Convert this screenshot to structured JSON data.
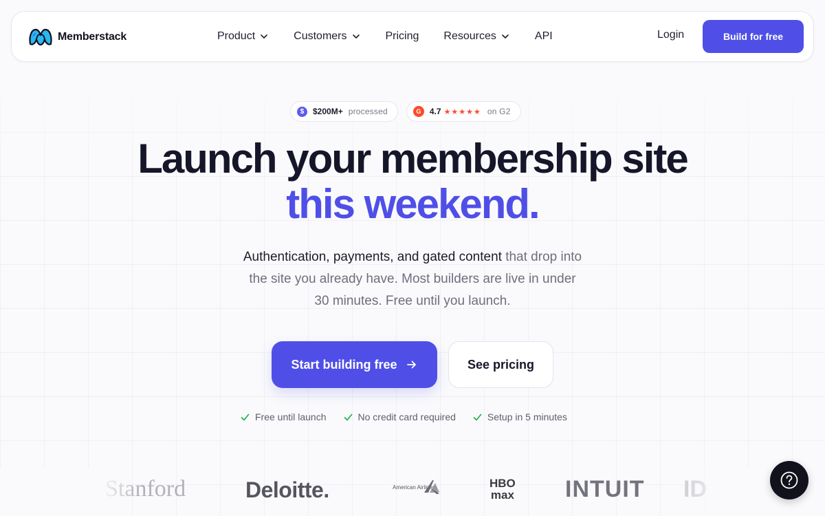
{
  "brand": {
    "name": "Memberstack",
    "accent": "#4f4fe8"
  },
  "nav": {
    "items": [
      {
        "label": "Product",
        "has_dropdown": true
      },
      {
        "label": "Customers",
        "has_dropdown": true
      },
      {
        "label": "Pricing",
        "has_dropdown": false
      },
      {
        "label": "Resources",
        "has_dropdown": true
      },
      {
        "label": "API",
        "has_dropdown": false
      }
    ],
    "login": "Login",
    "cta": "Build for free"
  },
  "badges": {
    "processed_value": "$200M+",
    "processed_label": "processed",
    "rating": "4.7",
    "rating_stars": "★★★★★",
    "rating_label": "on G2"
  },
  "hero": {
    "headline_line1": "Launch your membership site",
    "headline_line2": "this weekend.",
    "sub_dark": "Authentication, payments, and gated content",
    "sub_rest": " that drop into the site you already have. Most builders are live in under 30 minutes. Free until you launch.",
    "cta_primary": "Start building free",
    "cta_secondary": "See pricing",
    "checks": [
      "Free until launch",
      "No credit card required",
      "Setup in 5 minutes"
    ]
  },
  "customer_logos": {
    "stanford": "Stanford",
    "deloitte": "Deloitte.",
    "american_airlines": "American Airlines",
    "hbo_top": "HBO",
    "hbo_bottom": "max",
    "intuit": "INTUIT",
    "partial": "ID"
  },
  "icons": {
    "chevron": "chevron-down-icon",
    "arrow": "arrow-right-icon",
    "check": "check-icon",
    "help": "help-question-icon"
  },
  "colors": {
    "check_green": "#22b04a",
    "g2_red": "#ff492c",
    "help_bg": "#12121c"
  }
}
